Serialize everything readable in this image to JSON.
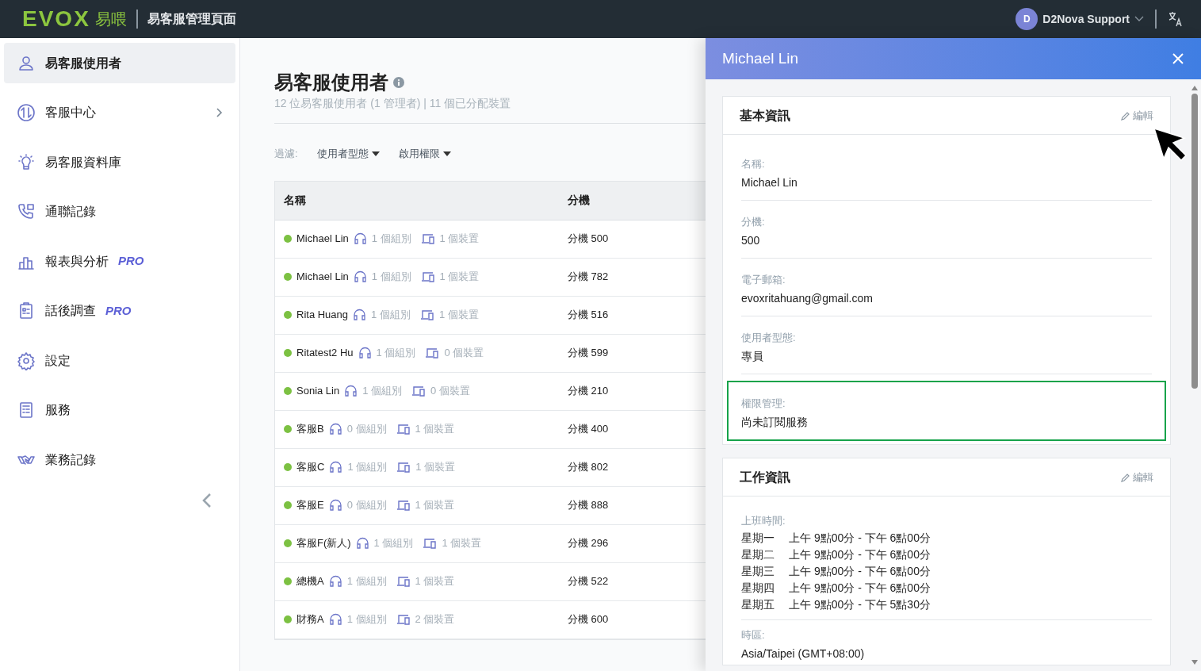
{
  "header": {
    "logo_text": "EVOX",
    "logo_cn": "易喂",
    "title": "易客服管理頁面",
    "user": {
      "initial": "D",
      "name": "D2Nova Support"
    }
  },
  "sidebar": {
    "items": [
      {
        "label": "易客服使用者",
        "selected": true,
        "submenu": false
      },
      {
        "label": "客服中心",
        "selected": false,
        "submenu": true
      },
      {
        "label": "易客服資料庫",
        "selected": false,
        "submenu": false
      },
      {
        "label": "通聯記錄",
        "selected": false,
        "submenu": false
      },
      {
        "label": "報表與分析",
        "badge": "PRO",
        "selected": false,
        "submenu": false
      },
      {
        "label": "話後調查",
        "badge": "PRO",
        "selected": false,
        "submenu": false
      },
      {
        "label": "設定",
        "selected": false,
        "submenu": false
      },
      {
        "label": "服務",
        "selected": false,
        "submenu": false
      },
      {
        "label": "業務記錄",
        "selected": false,
        "submenu": false
      }
    ]
  },
  "main": {
    "title": "易客服使用者",
    "subtitle": "12 位易客服使用者 (1 管理者) | 11 個已分配裝置",
    "filter_label": "過濾:",
    "filters": [
      "使用者型態",
      "啟用權限"
    ],
    "table": {
      "columns": [
        "名稱",
        "分機"
      ],
      "rows": [
        {
          "name": "Michael Lin",
          "color": "#7cc142",
          "groups": "1 個組別",
          "devices": "1 個裝置",
          "extension": "分機 500"
        },
        {
          "name": "Michael Lin",
          "color": "#7cc142",
          "groups": "1 個組別",
          "devices": "1 個裝置",
          "extension": "分機 782"
        },
        {
          "name": "Rita Huang",
          "color": "#7cc142",
          "groups": "1 個組別",
          "devices": "1 個裝置",
          "extension": "分機 516"
        },
        {
          "name": "Ritatest2 Hu",
          "color": "#7cc142",
          "groups": "1 個組別",
          "devices": "0 個裝置",
          "extension": "分機 599"
        },
        {
          "name": "Sonia Lin",
          "color": "#7cc142",
          "groups": "1 個組別",
          "devices": "0 個裝置",
          "extension": "分機 210"
        },
        {
          "name": "客服B",
          "color": "#7cc142",
          "groups": "0 個組別",
          "devices": "1 個裝置",
          "extension": "分機 400"
        },
        {
          "name": "客服C",
          "color": "#7cc142",
          "groups": "1 個組別",
          "devices": "1 個裝置",
          "extension": "分機 802"
        },
        {
          "name": "客服E",
          "color": "#7cc142",
          "groups": "0 個組別",
          "devices": "1 個裝置",
          "extension": "分機 888"
        },
        {
          "name": "客服F(新人)",
          "color": "#7cc142",
          "groups": "1 個組別",
          "devices": "1 個裝置",
          "extension": "分機 296"
        },
        {
          "name": "總機A",
          "color": "#7cc142",
          "groups": "1 個組別",
          "devices": "1 個裝置",
          "extension": "分機 522"
        },
        {
          "name": "財務A",
          "color": "#7cc142",
          "groups": "1 個組別",
          "devices": "2 個裝置",
          "extension": "分機 600"
        }
      ]
    }
  },
  "panel": {
    "title": "Michael Lin",
    "sections": [
      {
        "title": "基本資訊",
        "edit_label": "編輯",
        "fields": [
          {
            "label": "名稱:",
            "value": "Michael Lin",
            "highlighted": false
          },
          {
            "label": "分機:",
            "value": "500",
            "highlighted": false
          },
          {
            "label": "電子郵箱:",
            "value": "evoxritahuang@gmail.com",
            "highlighted": false
          },
          {
            "label": "使用者型態:",
            "value": "專員",
            "highlighted": false
          },
          {
            "label": "權限管理:",
            "value": "尚未訂閱服務",
            "highlighted": true
          }
        ]
      },
      {
        "title": "工作資訊",
        "edit_label": "編輯",
        "fields": [
          {
            "label": "上班時間:",
            "schedule": [
              {
                "day": "星期一",
                "hours": "上午 9點00分 - 下午 6點00分"
              },
              {
                "day": "星期二",
                "hours": "上午 9點00分 - 下午 6點00分"
              },
              {
                "day": "星期三",
                "hours": "上午 9點00分 - 下午 6點00分"
              },
              {
                "day": "星期四",
                "hours": "上午 9點00分 - 下午 6點00分"
              },
              {
                "day": "星期五",
                "hours": "上午 9點00分 - 下午 5點30分"
              }
            ],
            "highlighted": false
          },
          {
            "label": "時區:",
            "value": "Asia/Taipei (GMT+08:00)",
            "highlighted": false
          }
        ]
      }
    ]
  }
}
